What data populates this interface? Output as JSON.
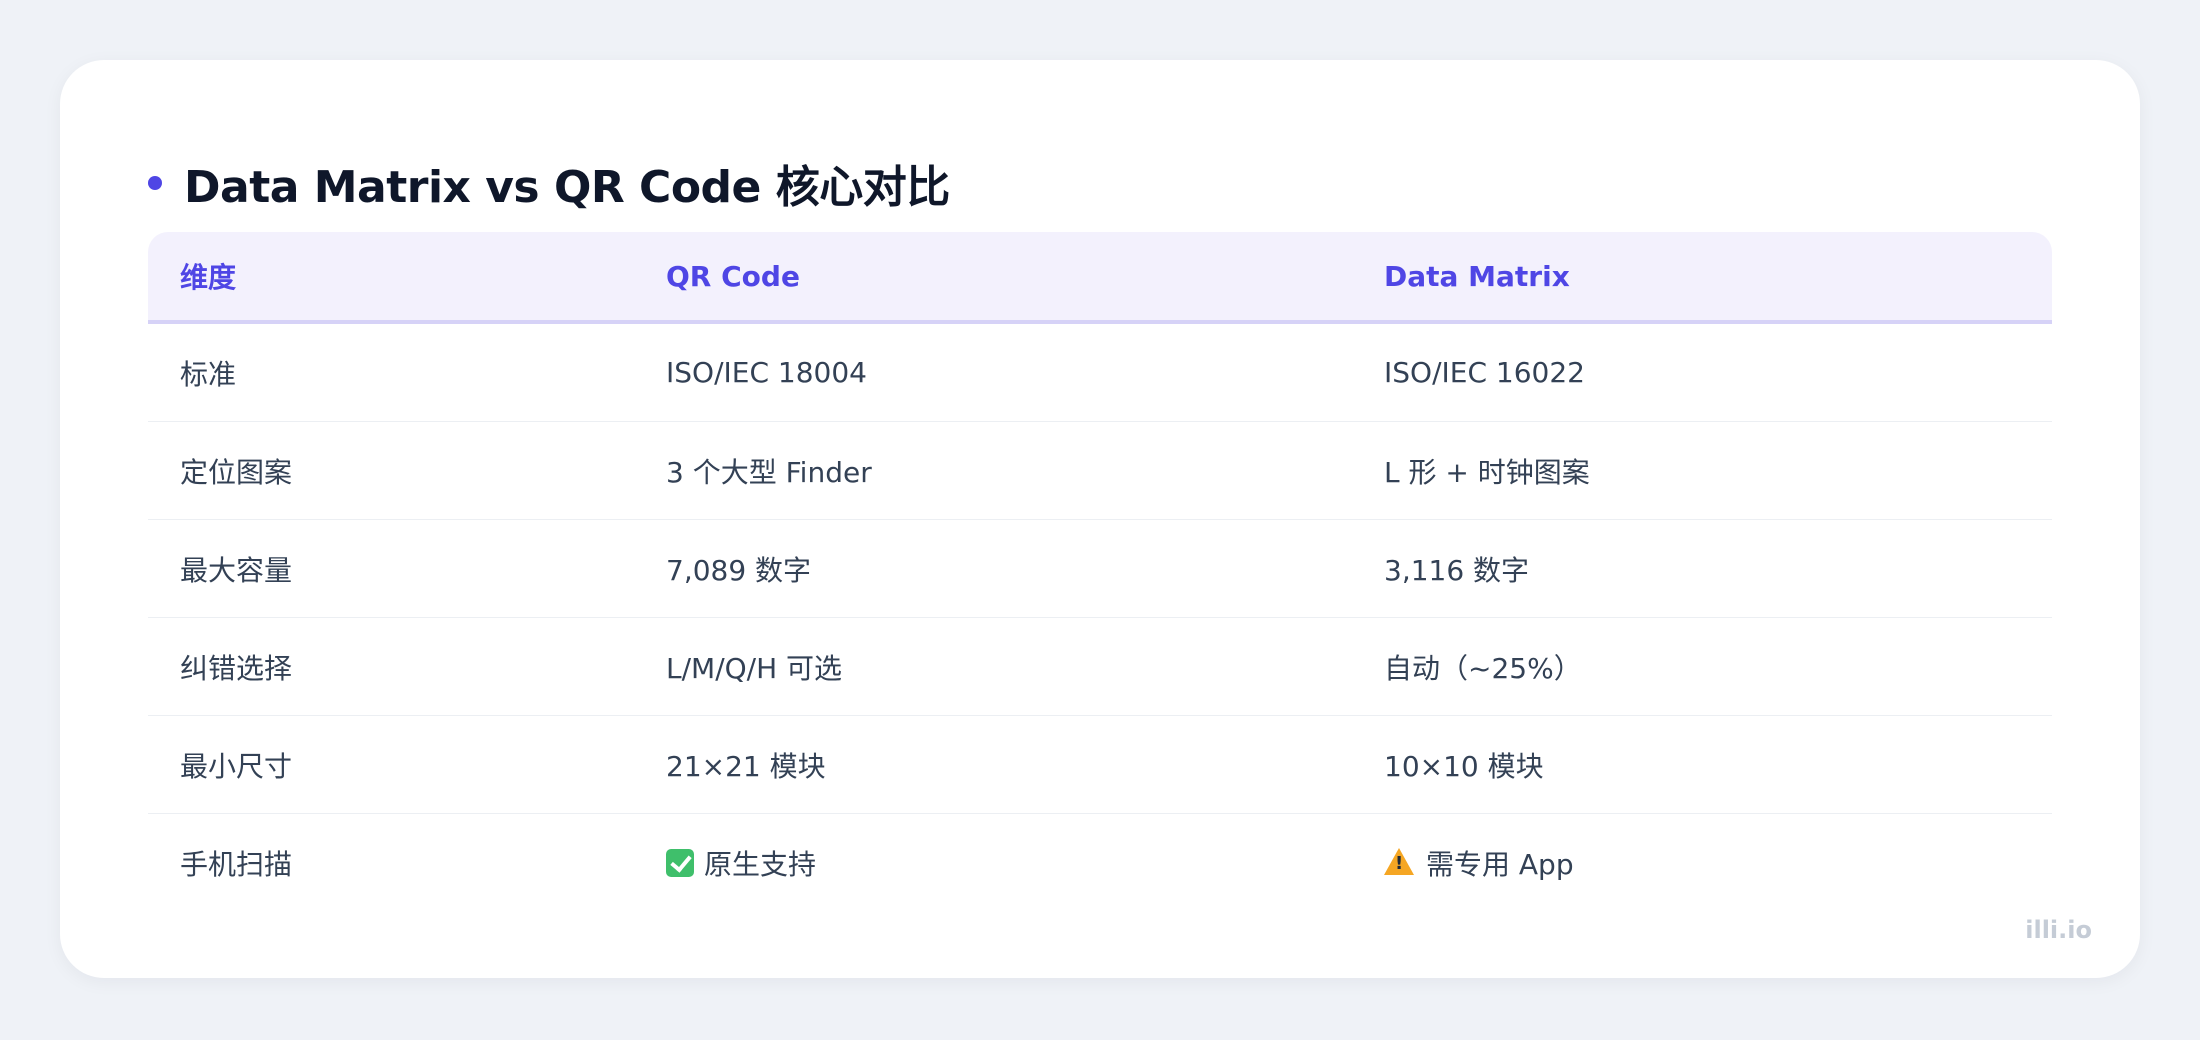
{
  "title": "Data Matrix vs QR Code 核心对比",
  "table": {
    "headers": [
      "维度",
      "QR Code",
      "Data Matrix"
    ],
    "rows": [
      {
        "dim": "标准",
        "qr": "ISO/IEC 18004",
        "dm": "ISO/IEC 16022"
      },
      {
        "dim": "定位图案",
        "qr": "3 个大型 Finder",
        "dm": "L 形 + 时钟图案"
      },
      {
        "dim": "最大容量",
        "qr": "7,089 数字",
        "dm": "3,116 数字"
      },
      {
        "dim": "纠错选择",
        "qr": "L/M/Q/H 可选",
        "dm": "自动（~25%）"
      },
      {
        "dim": "最小尺寸",
        "qr": "21×21 模块",
        "dm": "10×10 模块"
      },
      {
        "dim": "手机扫描",
        "qr": "原生支持",
        "dm": "需专用 App",
        "qr_icon": "check-mark-icon",
        "dm_icon": "warning-icon"
      }
    ]
  },
  "watermark": "illi.io",
  "colors": {
    "accent": "#4f46e5",
    "header_bg": "#f3f1fd",
    "background": "#eff2f7"
  }
}
